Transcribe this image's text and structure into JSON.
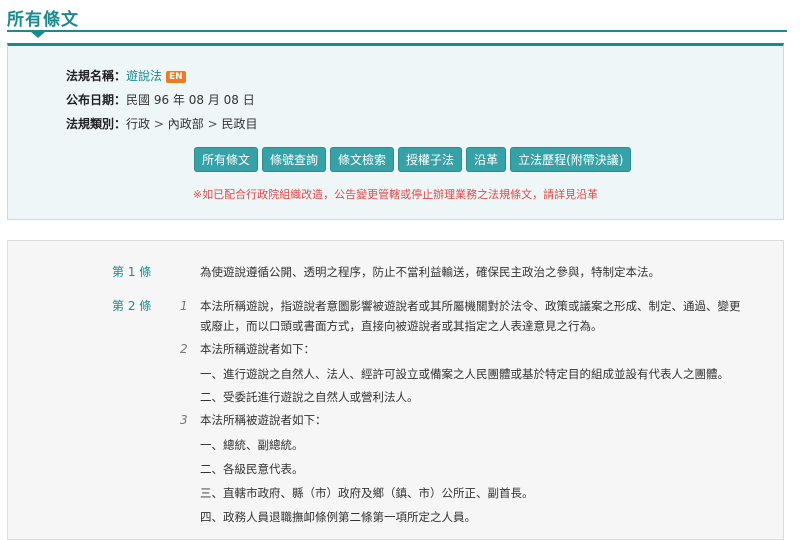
{
  "header": {
    "title": "所有條文"
  },
  "law": {
    "name_label": "法規名稱：",
    "name": "遊說法",
    "en_badge": "EN",
    "date_label": "公布日期：",
    "date": "民國 96 年 08 月 08 日",
    "category_label": "法規類別：",
    "category": [
      "行政",
      "內政部",
      "民政目"
    ],
    "category_sep": ">"
  },
  "buttons": [
    "所有條文",
    "條號查詢",
    "條文檢索",
    "授權子法",
    "沿革",
    "立法歷程(附帶決議)"
  ],
  "notice": "※如已配合行政院組織改造，公告變更管轄或停止辦理業務之法規條文，請詳見沿革",
  "articles": [
    {
      "number": "第 1 條",
      "paragraphs": [
        {
          "no": "",
          "lines": [
            "為使遊說遵循公開、透明之程序，防止不當利益輸送，確保民主政治之參與，特制定本法。"
          ]
        }
      ]
    },
    {
      "number": "第 2 條",
      "paragraphs": [
        {
          "no": "1",
          "lines": [
            "本法所稱遊說，指遊說者意圖影響被遊說者或其所屬機關對於法令、政策或議案之形成、制定、通過、變更",
            "或廢止，而以口頭或書面方式，直接向被遊說者或其指定之人表達意見之行為。"
          ]
        },
        {
          "no": "2",
          "lines": [
            "本法所稱遊說者如下：",
            "一、進行遊說之自然人、法人、經許可設立或備案之人民團體或基於特定目的組成並設有代表人之團體。",
            "二、受委託進行遊說之自然人或營利法人。"
          ]
        },
        {
          "no": "3",
          "lines": [
            "本法所稱被遊說者如下：",
            "一、總統、副總統。",
            "二、各級民意代表。",
            "三、直轄市政府、縣（市）政府及鄉（鎮、市）公所正、副首長。",
            "四、政務人員退職撫卹條例第二條第一項所定之人員。"
          ]
        }
      ]
    }
  ]
}
